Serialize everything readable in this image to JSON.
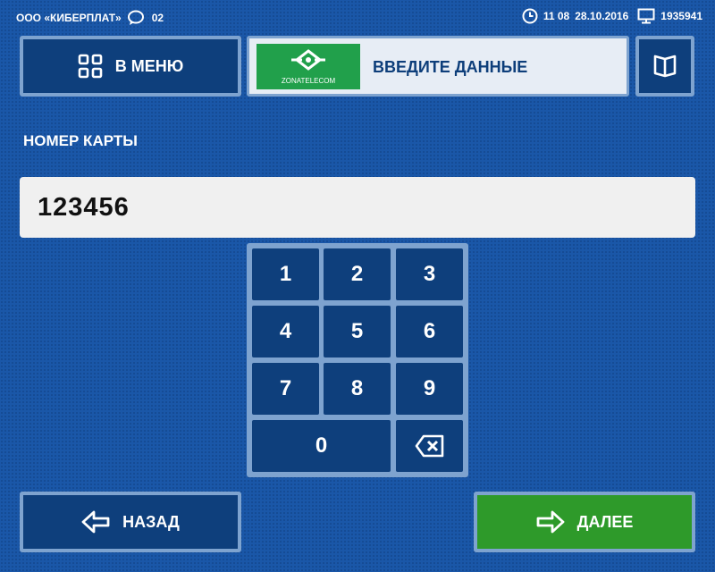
{
  "topbar": {
    "org": "ООО «КИБЕРПЛАТ»",
    "messages_count": "02",
    "time": "11 08",
    "date": "28.10.2016",
    "terminal_id": "1935941",
    "icons": [
      "chat-icon",
      "clock-icon",
      "monitor-icon"
    ]
  },
  "header": {
    "menu_label": "В МЕНЮ",
    "banner_title": "ВВЕДИТЕ ДАННЫЕ",
    "logo_text": "ZONATELECOM",
    "icons": [
      "grid-icon",
      "book-icon"
    ]
  },
  "form": {
    "field_label": "НОМЕР КАРТЫ",
    "field_value": "123456"
  },
  "keypad": {
    "keys": [
      "1",
      "2",
      "3",
      "4",
      "5",
      "6",
      "7",
      "8",
      "9",
      "0"
    ],
    "backspace_icon": "backspace-icon"
  },
  "footer": {
    "back_label": "НАЗАД",
    "next_label": "ДАЛЕЕ"
  },
  "colors": {
    "background": "#1a57a8",
    "button": "#0e3f7c",
    "button_border": "#7ea3cf",
    "next_button": "#2e9a2a",
    "logo_green": "#21a04b"
  }
}
